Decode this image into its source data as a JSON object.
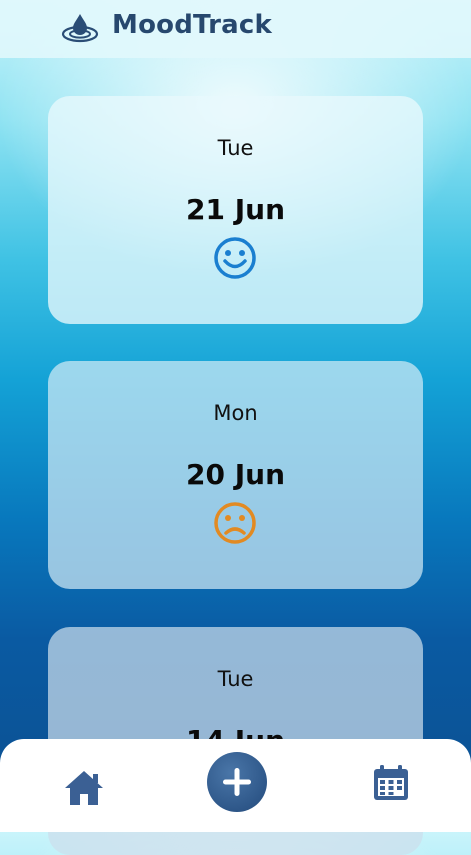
{
  "header": {
    "title": "MoodTrack",
    "logo_icon": "water-drop-ripple-icon"
  },
  "entries": [
    {
      "day": "Tue",
      "date": "21 Jun",
      "mood": "happy",
      "mood_color": "#1a7fd0"
    },
    {
      "day": "Mon",
      "date": "20 Jun",
      "mood": "sad",
      "mood_color": "#e28a22"
    },
    {
      "day": "Tue",
      "date": "14 Jun",
      "mood": "",
      "mood_color": ""
    }
  ],
  "nav": {
    "home_icon": "home-icon",
    "add_icon": "plus-icon",
    "calendar_icon": "calendar-icon",
    "accent": "#2e5789"
  },
  "colors": {
    "title": "#27486e",
    "icon": "#3b6094"
  }
}
